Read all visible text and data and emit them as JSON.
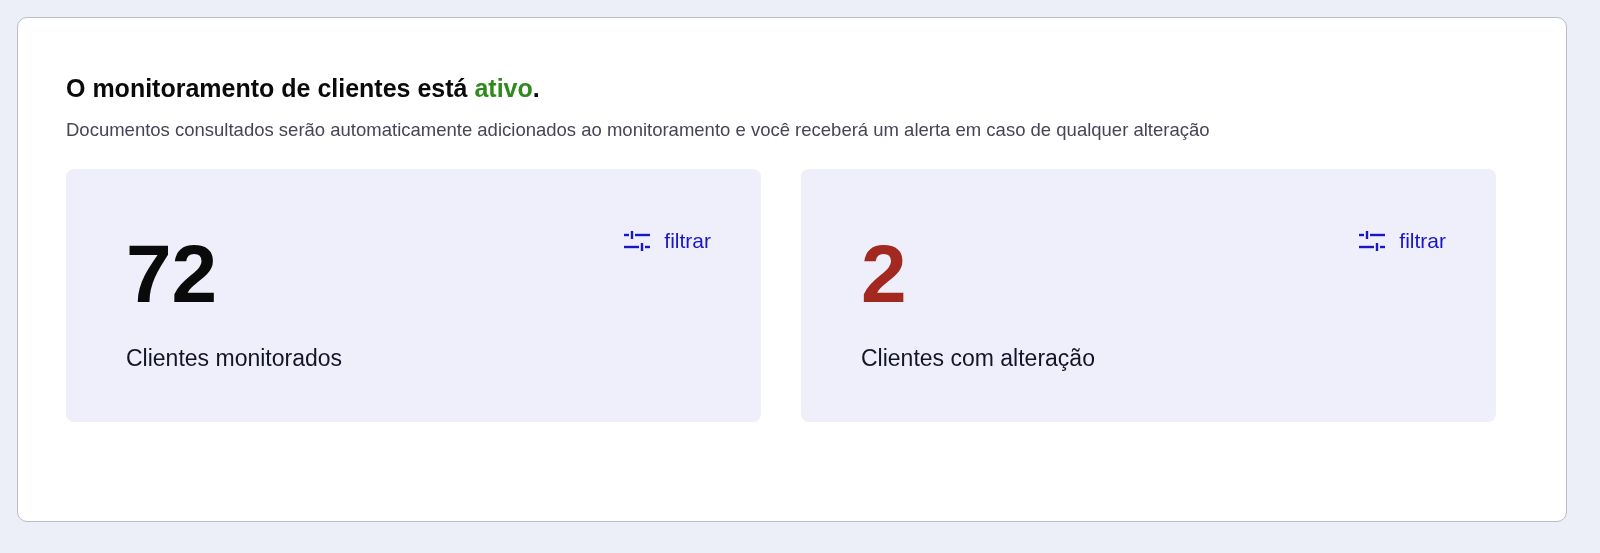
{
  "heading": {
    "text_before": "O monitoramento de clientes está",
    "status": "ativo",
    "text_after": "."
  },
  "description": "Documentos consultados serão automaticamente adicionados ao monitoramento e você receberá um alerta em caso de qualquer alteração",
  "stats": [
    {
      "value": "72",
      "label": "Clientes monitorados",
      "color": "#0a0a0a",
      "filter": "filtrar"
    },
    {
      "value": "2",
      "label": "Clientes com alteração",
      "color": "#a3281f",
      "filter": "filtrar"
    }
  ]
}
